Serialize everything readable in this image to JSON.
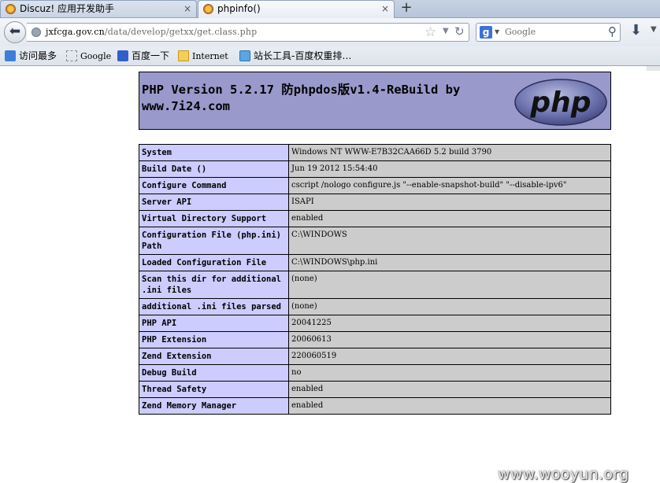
{
  "tabs": [
    {
      "title": "Discuz! 应用开发助手",
      "close": "×"
    },
    {
      "title": "phpinfo()",
      "close": "×"
    }
  ],
  "new_tab_label": "+",
  "address": {
    "host": "jxfcga.gov.cn",
    "path": "/data/develop/getxx/get.class.php"
  },
  "search": {
    "placeholder": "Google",
    "engine_letter": "g"
  },
  "bookmarks": [
    {
      "label": "访问最多"
    },
    {
      "label": "Google"
    },
    {
      "label": "百度一下"
    },
    {
      "label": "Internet"
    },
    {
      "label": "站长工具-百度权重排…"
    }
  ],
  "php": {
    "title": "PHP Version 5.2.17 防phpdos版v1.4-ReBuild by www.7i24.com",
    "logo_text": "php"
  },
  "info_rows": [
    {
      "key": "System",
      "value": "Windows NT WWW-E7B32CAA66D 5.2 build 3790"
    },
    {
      "key": "Build Date ()",
      "value": "Jun 19 2012 15:54:40"
    },
    {
      "key": "Configure Command",
      "value": "cscript /nologo configure.js \"--enable-snapshot-build\" \"--disable-ipv6\""
    },
    {
      "key": "Server API",
      "value": "ISAPI"
    },
    {
      "key": "Virtual Directory Support",
      "value": "enabled"
    },
    {
      "key": "Configuration File (php.ini) Path",
      "value": "C:\\WINDOWS"
    },
    {
      "key": "Loaded Configuration File",
      "value": "C:\\WINDOWS\\php.ini"
    },
    {
      "key": "Scan this dir for additional .ini files",
      "value": "(none)"
    },
    {
      "key": "additional .ini files parsed",
      "value": "(none)"
    },
    {
      "key": "PHP API",
      "value": "20041225"
    },
    {
      "key": "PHP Extension",
      "value": "20060613"
    },
    {
      "key": "Zend Extension",
      "value": "220060519"
    },
    {
      "key": "Debug Build",
      "value": "no"
    },
    {
      "key": "Thread Safety",
      "value": "enabled"
    },
    {
      "key": "Zend Memory Manager",
      "value": "enabled"
    }
  ],
  "watermark": "www.wooyun.org"
}
